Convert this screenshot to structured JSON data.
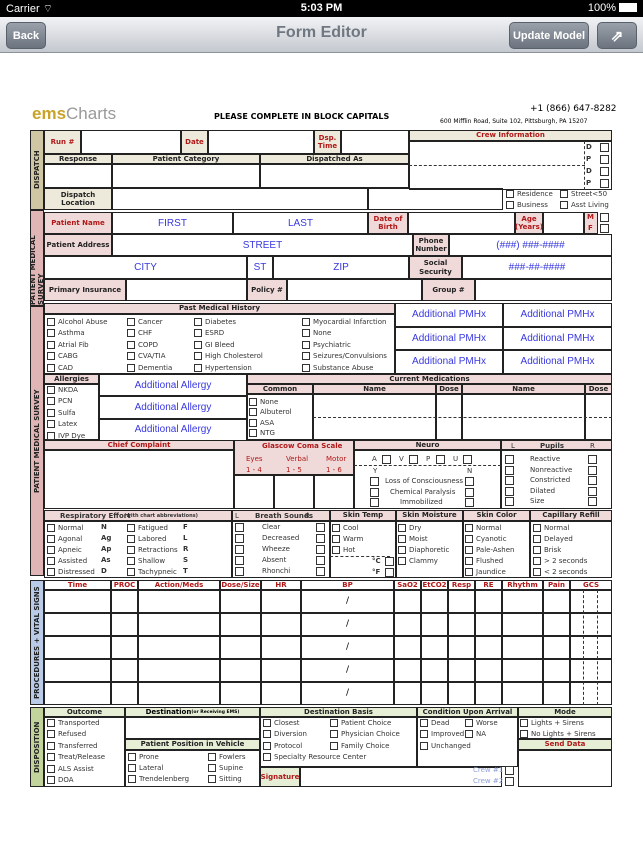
{
  "status_bar": {
    "carrier": "Carrier",
    "time": "5:03 PM",
    "battery": "100%"
  },
  "navbar": {
    "back": "Back",
    "title": "Form Editor",
    "update": "Update Model"
  },
  "header": {
    "logo_ems": "ems",
    "logo_charts": "Charts",
    "instruction": "PLEASE COMPLETE IN BLOCK CAPITALS",
    "phone": "+1 (866) 647-8282",
    "address": "600 Mifflin Road, Suite 102, Pittsburgh, PA 15207"
  },
  "dispatch": {
    "side": "DISPATCH",
    "run": "Run #",
    "date": "Date",
    "dsp_time": "Dsp. Time",
    "crew": "Crew Information",
    "response": "Response",
    "patient_category": "Patient Category",
    "dispatched_as": "Dispatched As",
    "dispatch_location": "Dispatch Location",
    "crew_roles": [
      "D",
      "P",
      "D",
      "P"
    ],
    "location_types": [
      "Residence",
      "Street<50",
      "Business",
      "Asst Living"
    ]
  },
  "patient": {
    "side": "PATIENT MEDICAL SURVEY",
    "name": "Patient Name",
    "first": "FIRST",
    "last": "LAST",
    "dob": "Date of Birth",
    "age": "Age (Years)",
    "m": "M",
    "f": "F",
    "address": "Patient Address",
    "street": "STREET",
    "phone": "Phone Number",
    "phone_ph": "(###) ###-####",
    "city": "CITY",
    "st": "ST",
    "zip": "ZIP",
    "ssn": "Social Security",
    "ssn_ph": "###-##-####",
    "insurance": "Primary Insurance",
    "policy": "Policy #",
    "group": "Group #"
  },
  "pmh": {
    "title": "Past Medical History",
    "items": [
      "Alcohol Abuse",
      "Asthma",
      "Atrial Fib",
      "CABG",
      "CAD",
      "Cancer",
      "CHF",
      "COPD",
      "CVA/TIA",
      "Dementia",
      "Diabetes",
      "ESRD",
      "GI Bleed",
      "High Cholesterol",
      "Hypertension",
      "Myocardial Infarction",
      "None",
      "Psychiatric",
      "Seizures/Convulsions",
      "Substance Abuse"
    ],
    "additional": "Additional PMHx"
  },
  "allergies": {
    "title": "Allergies",
    "items": [
      "NKDA",
      "PCN",
      "Sulfa",
      "Latex",
      "IVP Dye"
    ],
    "additional": "Additional Allergy"
  },
  "meds": {
    "title": "Current Medications",
    "common": "Common",
    "common_items": [
      "None",
      "Albuterol",
      "ASA",
      "NTG"
    ],
    "name": "Name",
    "dose": "Dose"
  },
  "complaint": {
    "title": "Chief Complaint"
  },
  "gcs": {
    "title": "Glascow Coma Scale",
    "cols": [
      {
        "label": "Eyes",
        "range": "1 - 4"
      },
      {
        "label": "Verbal",
        "range": "1 - 5"
      },
      {
        "label": "Motor",
        "range": "1 - 6"
      }
    ]
  },
  "neuro": {
    "title": "Neuro",
    "avpu": [
      "A",
      "V",
      "P",
      "U"
    ],
    "y": "Y",
    "n": "N",
    "items": [
      "Loss of Consciousness",
      "Chemical Paralysis",
      "Immobilized"
    ]
  },
  "pupils": {
    "title": "Pupils",
    "l": "L",
    "r": "R",
    "items": [
      "Reactive",
      "Nonreactive",
      "Constricted",
      "Dilated",
      "Size"
    ]
  },
  "resp": {
    "title": "Respiratory Effort",
    "subtitle": "(with chart abbreviations)",
    "items": [
      [
        "Normal",
        "N"
      ],
      [
        "Agonal",
        "Ag"
      ],
      [
        "Apneic",
        "Ap"
      ],
      [
        "Assisted",
        "As"
      ],
      [
        "Distressed",
        "D"
      ],
      [
        "Fatigued",
        "F"
      ],
      [
        "Labored",
        "L"
      ],
      [
        "Retractions",
        "R"
      ],
      [
        "Shallow",
        "S"
      ],
      [
        "Tachypneic",
        "T"
      ]
    ]
  },
  "breath": {
    "title": "Breath Sounds",
    "l": "L",
    "r": "R",
    "items": [
      "Clear",
      "Decreased",
      "Wheeze",
      "Absent",
      "Rhonchi"
    ]
  },
  "skin_temp": {
    "title": "Skin Temp",
    "items": [
      "Cool",
      "Warm",
      "Hot"
    ],
    "c": "°C",
    "f": "°F"
  },
  "skin_moist": {
    "title": "Skin Moisture",
    "items": [
      "Dry",
      "Moist",
      "Diaphoretic",
      "Clammy"
    ]
  },
  "skin_color": {
    "title": "Skin Color",
    "items": [
      "Normal",
      "Cyanotic",
      "Pale-Ashen",
      "Flushed",
      "Jaundice"
    ]
  },
  "cap": {
    "title": "Capillary Refill",
    "items": [
      "Normal",
      "Delayed",
      "Brisk",
      "> 2 seconds",
      "< 2 seconds"
    ]
  },
  "vitals": {
    "side": "PROCEDURES + VITAL SIGNS",
    "cols": [
      "Time",
      "PROC",
      "Action/Meds",
      "Dose/Size",
      "HR",
      "BP",
      "SaO2",
      "EtCO2",
      "Resp",
      "RE",
      "Rhythm",
      "Pain",
      "GCS"
    ],
    "slash": "/"
  },
  "disposition": {
    "side": "DISPOSITION",
    "outcome": "Outcome",
    "outcome_items": [
      "Transported",
      "Refused",
      "Transferred",
      "Treat/Release",
      "ALS Assist",
      "DOA"
    ],
    "destination": "Destination",
    "destination_sub": "(or Receiving EMS)",
    "position": "Patient Position in Vehicle",
    "position_items": [
      "Prone",
      "Lateral",
      "Trendelenberg",
      "Fowlers",
      "Supine",
      "Sitting"
    ],
    "basis": "Destination Basis",
    "basis_items": [
      "Closest",
      "Diversion",
      "Protocol",
      "Patient Choice",
      "Physician Choice",
      "Family Choice",
      "Specialty Resource Center"
    ],
    "condition": "Condition Upon Arrival",
    "condition_items": [
      "Dead",
      "Improved",
      "Unchanged",
      "Worse",
      "NA"
    ],
    "mode": "Mode",
    "mode_items": [
      "Lights + Sirens",
      "No Lights + Sirens"
    ],
    "send": "Send Data",
    "signature": "Signature",
    "crew1": "Crew #1",
    "crew2": "Crew #2"
  }
}
